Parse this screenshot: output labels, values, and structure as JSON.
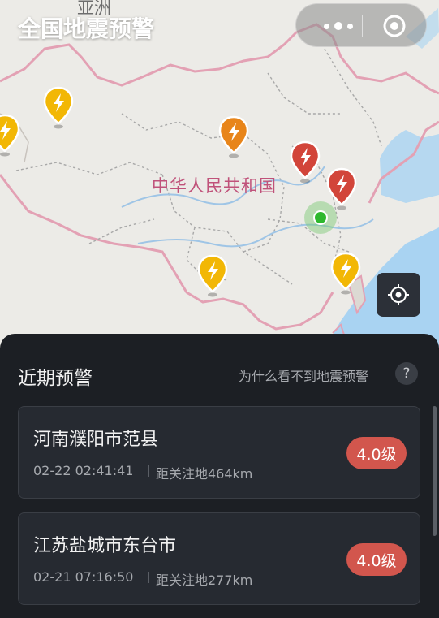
{
  "header": {
    "title": "全国地震预警",
    "more_icon": "more-dots-icon",
    "close_icon": "target-circle-icon"
  },
  "map": {
    "continent_label": "亚洲",
    "country_label": "中华人民共和国",
    "pins": [
      {
        "name": "quake-pin-west-1",
        "color": "#f2b705"
      },
      {
        "name": "quake-pin-west-2",
        "color": "#f2b705"
      },
      {
        "name": "quake-pin-north",
        "color": "#e8851a"
      },
      {
        "name": "quake-pin-east-1",
        "color": "#d2453a"
      },
      {
        "name": "quake-pin-east-2",
        "color": "#d2453a"
      },
      {
        "name": "quake-pin-south",
        "color": "#f2b705"
      },
      {
        "name": "quake-pin-southeast",
        "color": "#f2b705"
      }
    ],
    "locate_icon": "locate-crosshair-icon"
  },
  "panel": {
    "title": "近期预警",
    "why_link": "为什么看不到地震预警",
    "help_symbol": "?"
  },
  "alerts": [
    {
      "place": "河南濮阳市范县",
      "time": "02-22 02:41:41",
      "distance": "距关注地464km",
      "magnitude": "4.0级"
    },
    {
      "place": "江苏盐城市东台市",
      "time": "02-21 07:16:50",
      "distance": "距关注地277km",
      "magnitude": "4.0级"
    }
  ],
  "colors": {
    "panel_bg": "#1c1f24",
    "card_bg": "#262a31",
    "magnitude_badge": "#d2564d",
    "map_land": "#ecebe7",
    "map_border": "#e3a1b4",
    "map_sea": "#a9d3f2"
  }
}
